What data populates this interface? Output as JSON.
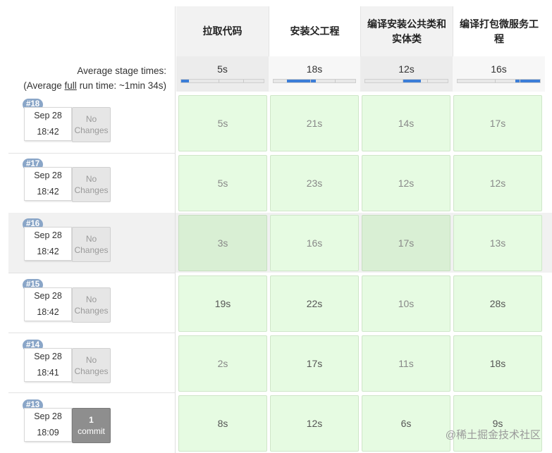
{
  "header": {
    "stages": [
      {
        "name": "拉取代码"
      },
      {
        "name": "安装父工程"
      },
      {
        "name": "编译安装公共类和实体类"
      },
      {
        "name": "编译打包微服务工程"
      }
    ]
  },
  "averages": {
    "label_line1": "Average stage times:",
    "label_prefix": "(Average ",
    "label_link": "full",
    "label_suffix": " run time: ~1min 34s)",
    "times": [
      "5s",
      "18s",
      "12s",
      "16s"
    ],
    "progress": [
      0.09,
      0.33,
      0.22,
      0.3
    ]
  },
  "builds": [
    {
      "badge": "#18",
      "date": "Sep 28",
      "time": "18:42",
      "changes_l1": "No",
      "changes_l2": "Changes",
      "stages": [
        "5s",
        "21s",
        "14s",
        "17s"
      ]
    },
    {
      "badge": "#17",
      "date": "Sep 28",
      "time": "18:42",
      "changes_l1": "No",
      "changes_l2": "Changes",
      "stages": [
        "5s",
        "23s",
        "12s",
        "12s"
      ]
    },
    {
      "badge": "#16",
      "date": "Sep 28",
      "time": "18:42",
      "changes_l1": "No",
      "changes_l2": "Changes",
      "stages": [
        "3s",
        "16s",
        "17s",
        "13s"
      ]
    },
    {
      "badge": "#15",
      "date": "Sep 28",
      "time": "18:42",
      "changes_l1": "No",
      "changes_l2": "Changes",
      "stages": [
        "19s",
        "22s",
        "10s",
        "28s"
      ]
    },
    {
      "badge": "#14",
      "date": "Sep 28",
      "time": "18:41",
      "changes_l1": "No",
      "changes_l2": "Changes",
      "stages": [
        "2s",
        "17s",
        "11s",
        "18s"
      ]
    },
    {
      "badge": "#13",
      "date": "Sep 28",
      "time": "18:09",
      "changes_l1": "1",
      "changes_l2": "commit",
      "stages": [
        "8s",
        "12s",
        "6s",
        "9s"
      ]
    }
  ],
  "watermark": "@稀土掘金技术社区",
  "colors": {
    "progress": "#3b7dd8",
    "cell_success": "#e6fbe2",
    "badge": "#8aa6c8"
  }
}
